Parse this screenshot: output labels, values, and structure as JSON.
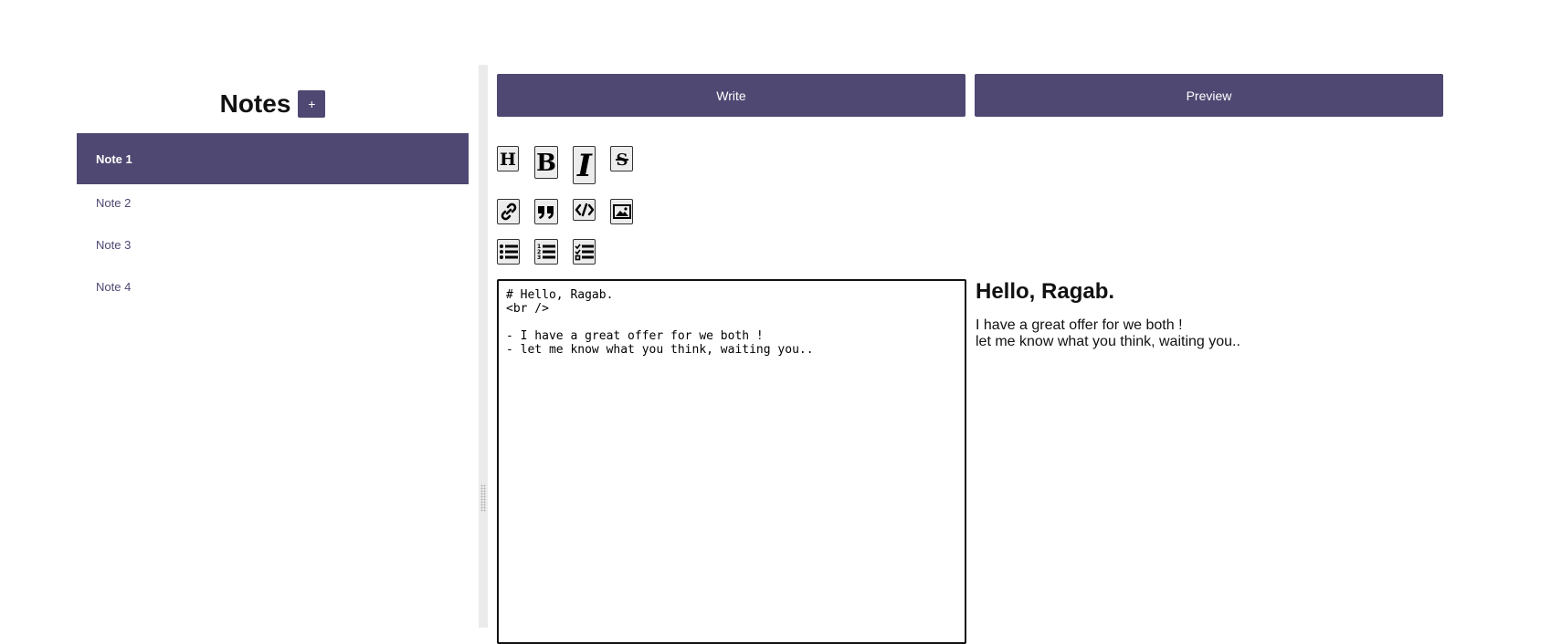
{
  "sidebar": {
    "title": "Notes",
    "add_label": "+",
    "notes": [
      {
        "label": "Note 1",
        "active": true
      },
      {
        "label": "Note 2",
        "active": false
      },
      {
        "label": "Note 3",
        "active": false
      },
      {
        "label": "Note 4",
        "active": false
      }
    ]
  },
  "tabs": {
    "write_label": "Write",
    "preview_label": "Preview"
  },
  "toolbar": {
    "tools": [
      "heading-icon",
      "bold-icon",
      "italic-icon",
      "strikethrough-icon",
      "link-icon",
      "quote-icon",
      "code-icon",
      "image-icon",
      "bulleted-list-icon",
      "numbered-list-icon",
      "checklist-icon"
    ]
  },
  "editor": {
    "content": "# Hello, Ragab.\n<br />\n\n- I have a great offer for we both !\n- let me know what you think, waiting you.."
  },
  "preview": {
    "heading": "Hello, Ragab.",
    "lines": [
      "I have a great offer for we both !",
      "let me know what you think, waiting you.."
    ]
  },
  "colors": {
    "accent": "#4e4872",
    "splitter": "#ebebeb"
  }
}
